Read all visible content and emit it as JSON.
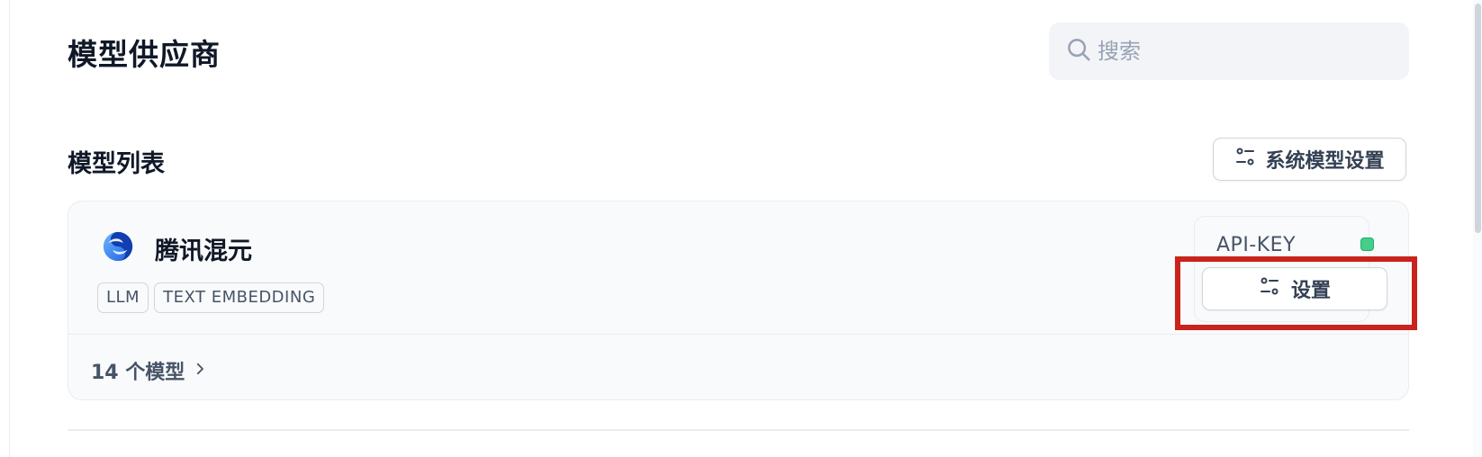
{
  "header": {
    "title": "模型供应商",
    "search_placeholder": "搜索",
    "search_value": ""
  },
  "section": {
    "title": "模型列表",
    "system_settings_label": "系统模型设置"
  },
  "provider": {
    "name": "腾讯混元",
    "tags": [
      "LLM",
      "TEXT EMBEDDING"
    ],
    "credential_label": "API-KEY",
    "status_color": "#47cd89",
    "settings_label": "设置",
    "models_link": "14 个模型"
  },
  "icons": {
    "search": "search-icon",
    "sliders": "sliders-icon",
    "chevron": "chevron-right-icon",
    "logo": "hunyuan-logo"
  },
  "colors": {
    "highlight": "#c9231b"
  }
}
